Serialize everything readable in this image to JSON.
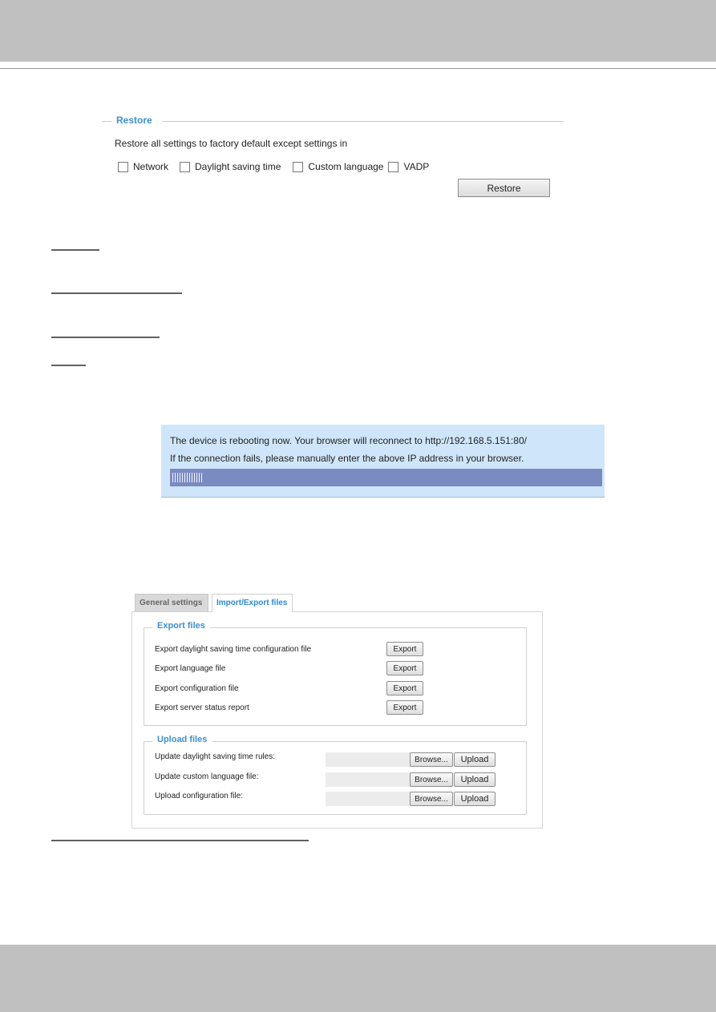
{
  "restore": {
    "legend": "Restore",
    "description": "Restore all settings to factory default except settings in",
    "options": [
      {
        "label": "Network",
        "checked": false
      },
      {
        "label": "Daylight saving time",
        "checked": false
      },
      {
        "label": "Custom language",
        "checked": false
      },
      {
        "label": "VADP",
        "checked": false
      }
    ],
    "button_label": "Restore"
  },
  "reboot_notice": {
    "line1": "The device is rebooting now. Your browser will reconnect to http://192.168.5.151:80/",
    "line2": "If the connection fails, please manually enter the above IP address in your browser.",
    "progress_percent": 7,
    "colors": {
      "background": "#cfe6fa",
      "progress_track": "#7a8bc2"
    }
  },
  "tabs": [
    {
      "label": "General settings",
      "active": false
    },
    {
      "label": "Import/Export files",
      "active": true
    }
  ],
  "export_files": {
    "legend": "Export files",
    "rows": [
      {
        "label": "Export daylight saving time configuration file",
        "button": "Export"
      },
      {
        "label": "Export language file",
        "button": "Export"
      },
      {
        "label": "Export configuration file",
        "button": "Export"
      },
      {
        "label": "Export server status report",
        "button": "Export"
      }
    ]
  },
  "upload_files": {
    "legend": "Upload files",
    "rows": [
      {
        "label": "Update daylight saving time rules:",
        "value": "",
        "browse": "Browse...",
        "upload": "Upload"
      },
      {
        "label": "Update custom language file:",
        "value": "",
        "browse": "Browse...",
        "upload": "Upload"
      },
      {
        "label": "Upload configuration file:",
        "value": "",
        "browse": "Browse...",
        "upload": "Upload"
      }
    ]
  },
  "accent_color": "#3c8fd0"
}
